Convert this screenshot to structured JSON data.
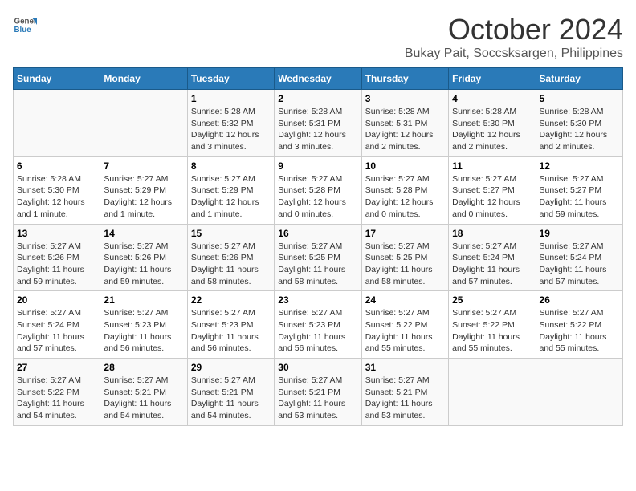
{
  "header": {
    "logo_general": "General",
    "logo_blue": "Blue",
    "month": "October 2024",
    "location": "Bukay Pait, Soccsksargen, Philippines"
  },
  "weekdays": [
    "Sunday",
    "Monday",
    "Tuesday",
    "Wednesday",
    "Thursday",
    "Friday",
    "Saturday"
  ],
  "weeks": [
    [
      {
        "day": "",
        "detail": ""
      },
      {
        "day": "",
        "detail": ""
      },
      {
        "day": "1",
        "detail": "Sunrise: 5:28 AM\nSunset: 5:32 PM\nDaylight: 12 hours and 3 minutes."
      },
      {
        "day": "2",
        "detail": "Sunrise: 5:28 AM\nSunset: 5:31 PM\nDaylight: 12 hours and 3 minutes."
      },
      {
        "day": "3",
        "detail": "Sunrise: 5:28 AM\nSunset: 5:31 PM\nDaylight: 12 hours and 2 minutes."
      },
      {
        "day": "4",
        "detail": "Sunrise: 5:28 AM\nSunset: 5:30 PM\nDaylight: 12 hours and 2 minutes."
      },
      {
        "day": "5",
        "detail": "Sunrise: 5:28 AM\nSunset: 5:30 PM\nDaylight: 12 hours and 2 minutes."
      }
    ],
    [
      {
        "day": "6",
        "detail": "Sunrise: 5:28 AM\nSunset: 5:30 PM\nDaylight: 12 hours and 1 minute."
      },
      {
        "day": "7",
        "detail": "Sunrise: 5:27 AM\nSunset: 5:29 PM\nDaylight: 12 hours and 1 minute."
      },
      {
        "day": "8",
        "detail": "Sunrise: 5:27 AM\nSunset: 5:29 PM\nDaylight: 12 hours and 1 minute."
      },
      {
        "day": "9",
        "detail": "Sunrise: 5:27 AM\nSunset: 5:28 PM\nDaylight: 12 hours and 0 minutes."
      },
      {
        "day": "10",
        "detail": "Sunrise: 5:27 AM\nSunset: 5:28 PM\nDaylight: 12 hours and 0 minutes."
      },
      {
        "day": "11",
        "detail": "Sunrise: 5:27 AM\nSunset: 5:27 PM\nDaylight: 12 hours and 0 minutes."
      },
      {
        "day": "12",
        "detail": "Sunrise: 5:27 AM\nSunset: 5:27 PM\nDaylight: 11 hours and 59 minutes."
      }
    ],
    [
      {
        "day": "13",
        "detail": "Sunrise: 5:27 AM\nSunset: 5:26 PM\nDaylight: 11 hours and 59 minutes."
      },
      {
        "day": "14",
        "detail": "Sunrise: 5:27 AM\nSunset: 5:26 PM\nDaylight: 11 hours and 59 minutes."
      },
      {
        "day": "15",
        "detail": "Sunrise: 5:27 AM\nSunset: 5:26 PM\nDaylight: 11 hours and 58 minutes."
      },
      {
        "day": "16",
        "detail": "Sunrise: 5:27 AM\nSunset: 5:25 PM\nDaylight: 11 hours and 58 minutes."
      },
      {
        "day": "17",
        "detail": "Sunrise: 5:27 AM\nSunset: 5:25 PM\nDaylight: 11 hours and 58 minutes."
      },
      {
        "day": "18",
        "detail": "Sunrise: 5:27 AM\nSunset: 5:24 PM\nDaylight: 11 hours and 57 minutes."
      },
      {
        "day": "19",
        "detail": "Sunrise: 5:27 AM\nSunset: 5:24 PM\nDaylight: 11 hours and 57 minutes."
      }
    ],
    [
      {
        "day": "20",
        "detail": "Sunrise: 5:27 AM\nSunset: 5:24 PM\nDaylight: 11 hours and 57 minutes."
      },
      {
        "day": "21",
        "detail": "Sunrise: 5:27 AM\nSunset: 5:23 PM\nDaylight: 11 hours and 56 minutes."
      },
      {
        "day": "22",
        "detail": "Sunrise: 5:27 AM\nSunset: 5:23 PM\nDaylight: 11 hours and 56 minutes."
      },
      {
        "day": "23",
        "detail": "Sunrise: 5:27 AM\nSunset: 5:23 PM\nDaylight: 11 hours and 56 minutes."
      },
      {
        "day": "24",
        "detail": "Sunrise: 5:27 AM\nSunset: 5:22 PM\nDaylight: 11 hours and 55 minutes."
      },
      {
        "day": "25",
        "detail": "Sunrise: 5:27 AM\nSunset: 5:22 PM\nDaylight: 11 hours and 55 minutes."
      },
      {
        "day": "26",
        "detail": "Sunrise: 5:27 AM\nSunset: 5:22 PM\nDaylight: 11 hours and 55 minutes."
      }
    ],
    [
      {
        "day": "27",
        "detail": "Sunrise: 5:27 AM\nSunset: 5:22 PM\nDaylight: 11 hours and 54 minutes."
      },
      {
        "day": "28",
        "detail": "Sunrise: 5:27 AM\nSunset: 5:21 PM\nDaylight: 11 hours and 54 minutes."
      },
      {
        "day": "29",
        "detail": "Sunrise: 5:27 AM\nSunset: 5:21 PM\nDaylight: 11 hours and 54 minutes."
      },
      {
        "day": "30",
        "detail": "Sunrise: 5:27 AM\nSunset: 5:21 PM\nDaylight: 11 hours and 53 minutes."
      },
      {
        "day": "31",
        "detail": "Sunrise: 5:27 AM\nSunset: 5:21 PM\nDaylight: 11 hours and 53 minutes."
      },
      {
        "day": "",
        "detail": ""
      },
      {
        "day": "",
        "detail": ""
      }
    ]
  ]
}
